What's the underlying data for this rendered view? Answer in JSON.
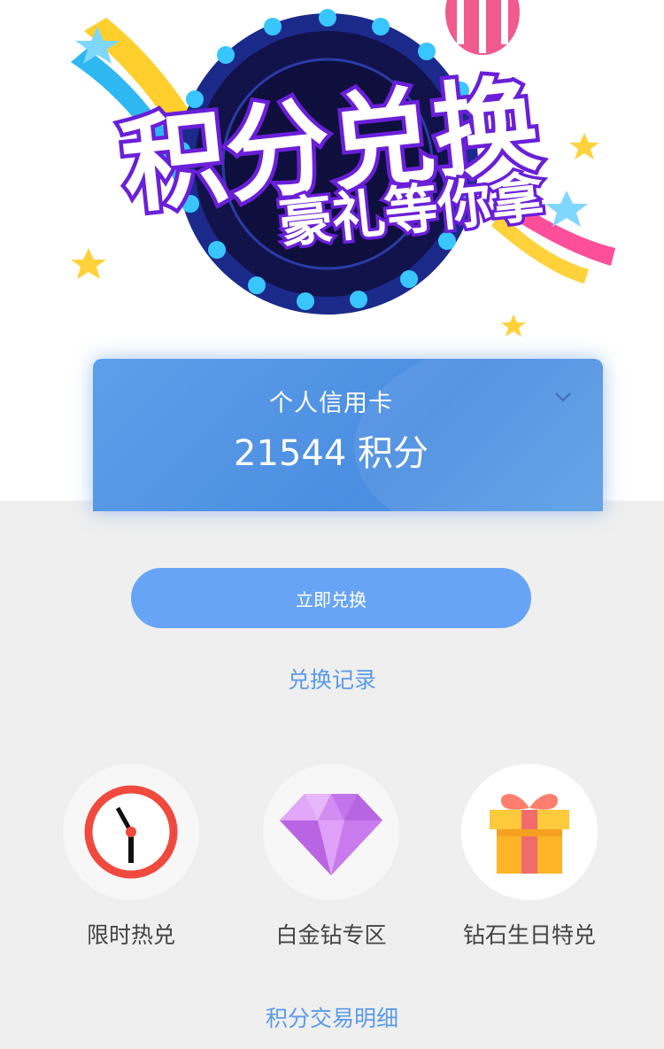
{
  "banner": {
    "title": "积分兑换",
    "subtitle": "豪礼等你拿",
    "colors": {
      "navy": "#12124a",
      "ring": "#1b2a8a",
      "light": "#39c6ff",
      "title_fill": "#ffffff",
      "title_outline": "#6a1fd8",
      "subtitle_fill": "#ffffff"
    }
  },
  "card": {
    "title": "个人信用卡",
    "points": "21544 积分",
    "dropdown_icon": "chevron-down-icon",
    "colors": {
      "start": "#5e9fea",
      "end": "#4b8de0"
    }
  },
  "actions": {
    "redeem_button": "立即兑换",
    "records_link": "兑换记录",
    "detail_link": "积分交易明细"
  },
  "features": [
    {
      "label": "限时热兑",
      "icon": "clock-icon"
    },
    {
      "label": "白金钻专区",
      "icon": "diamond-icon"
    },
    {
      "label": "钻石生日特兑",
      "icon": "gift-icon"
    }
  ],
  "colors": {
    "accent": "#68a4f6",
    "link": "#5b9be8",
    "background": "#efefef"
  }
}
